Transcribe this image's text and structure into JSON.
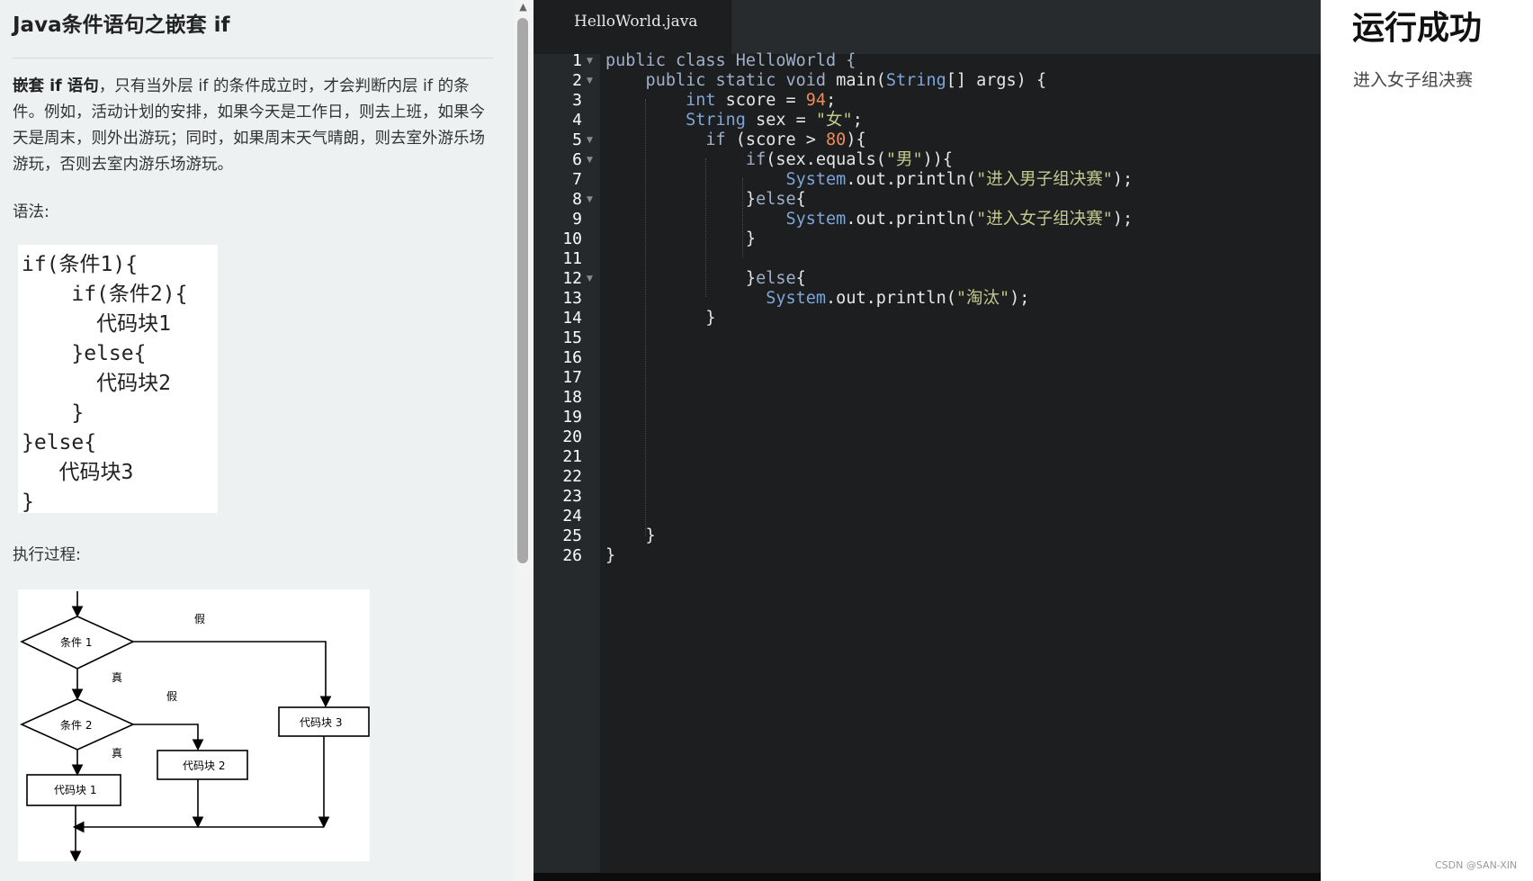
{
  "lesson": {
    "title": "Java条件语句之嵌套 if",
    "intro_bold": "嵌套 if 语句",
    "intro_rest": "，只有当外层 if 的条件成立时，才会判断内层 if 的条件。例如，活动计划的安排，如果今天是工作日，则去上班，如果今天是周末，则外出游玩；同时，如果周末天气晴朗，则去室外游乐场游玩，否则去室内游乐场游玩。",
    "syntax_label": "语法:",
    "syntax_code": "if(条件1){\n    if(条件2){\n      代码块1\n    }else{\n      代码块2\n    }\n}else{\n   代码块3\n}",
    "flow_label": "执行过程:",
    "flowchart": {
      "cond1": "条件 1",
      "cond2": "条件 2",
      "block1": "代码块 1",
      "block2": "代码块 2",
      "block3": "代码块 3",
      "true_label": "真",
      "false_label": "假"
    }
  },
  "editor": {
    "tab": "HelloWorld.java",
    "line_numbers": [
      "1",
      "2",
      "3",
      "4",
      "5",
      "6",
      "7",
      "8",
      "9",
      "10",
      "11",
      "12",
      "13",
      "14",
      "15",
      "16",
      "17",
      "18",
      "19",
      "20",
      "21",
      "22",
      "23",
      "24",
      "25",
      "26"
    ],
    "lines": {
      "l1": "public class HelloWorld {",
      "l2_a": "    public static void ",
      "l2_b": "main(",
      "l2_c": "String",
      "l2_d": "[] args) {",
      "l3_a": "        int",
      "l3_b": " score = ",
      "l3_c": "94",
      "l3_d": ";",
      "l4_a": "        String",
      "l4_b": " sex = ",
      "l4_c": "\"女\"",
      "l4_d": ";",
      "l5_a": "          if",
      "l5_b": " (score > ",
      "l5_c": "80",
      "l5_d": "){",
      "l6_a": "              if",
      "l6_b": "(sex.equals(",
      "l6_c": "\"男\"",
      "l6_d": ")){",
      "l7_a": "                  System",
      "l7_b": ".out.println(",
      "l7_c": "\"进入男子组决赛\"",
      "l7_d": ");",
      "l8_a": "              }",
      "l8_b": "else",
      "l8_c": "{",
      "l9_a": "                  System",
      "l9_b": ".out.println(",
      "l9_c": "\"进入女子组决赛\"",
      "l9_d": ");",
      "l10": "              }",
      "l12_a": "              }",
      "l12_b": "else",
      "l12_c": "{",
      "l13_a": "                System",
      "l13_b": ".out.println(",
      "l13_c": "\"淘汰\"",
      "l13_d": ");",
      "l14": "          }",
      "l25": "    }",
      "l26": "}"
    }
  },
  "output": {
    "title": "运行成功",
    "text": "进入女子组决赛"
  },
  "watermark": "CSDN @SAN-XIN"
}
